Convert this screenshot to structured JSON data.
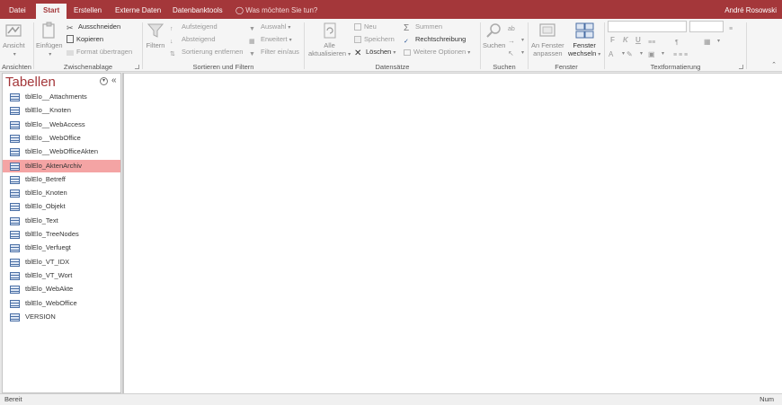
{
  "tabs": [
    {
      "label": "Datei"
    },
    {
      "label": "Start"
    },
    {
      "label": "Erstellen"
    },
    {
      "label": "Externe Daten"
    },
    {
      "label": "Datenbanktools"
    }
  ],
  "tell_me": "Was möchten Sie tun?",
  "user_name": "André Rosowski",
  "ribbon": {
    "ansichten": {
      "ansicht": "Ansicht",
      "label": "Ansichten"
    },
    "zwischenablage": {
      "einfuegen": "Einfügen",
      "ausschneiden": "Ausschneiden",
      "kopieren": "Kopieren",
      "format": "Format übertragen",
      "label": "Zwischenablage"
    },
    "sortieren": {
      "filtern": "Filtern",
      "aufsteigend": "Aufsteigend",
      "absteigend": "Absteigend",
      "sortierung_entfernen": "Sortierung entfernen",
      "auswahl": "Auswahl",
      "erweitert": "Erweitert",
      "filter_ein_aus": "Filter ein/aus",
      "label": "Sortieren und Filtern"
    },
    "datensaetze": {
      "alle": "Alle",
      "aktualisieren": "aktualisieren",
      "neu": "Neu",
      "speichern": "Speichern",
      "loeschen": "Löschen",
      "summen": "Summen",
      "rechtschreibung": "Rechtschreibung",
      "weitere": "Weitere Optionen",
      "label": "Datensätze"
    },
    "suchen": {
      "suchen": "Suchen",
      "label": "Suchen"
    },
    "fenster": {
      "anpassen_1": "An Fenster",
      "anpassen_2": "anpassen",
      "wechseln_1": "Fenster",
      "wechseln_2": "wechseln",
      "label": "Fenster"
    },
    "textformatierung": {
      "fett": "F",
      "kursiv": "K",
      "unterstrichen": "U",
      "label": "Textformatierung"
    }
  },
  "nav": {
    "title": "Tabellen",
    "items": [
      {
        "label": "tblElo__Attachments",
        "selected": false
      },
      {
        "label": "tblElo__Knoten",
        "selected": false
      },
      {
        "label": "tblElo__WebAccess",
        "selected": false
      },
      {
        "label": "tblElo__WebOffice",
        "selected": false
      },
      {
        "label": "tblElo__WebOfficeAkten",
        "selected": false
      },
      {
        "label": "tblElo_AktenArchiv",
        "selected": true
      },
      {
        "label": "tblElo_Betreff",
        "selected": false
      },
      {
        "label": "tblElo_Knoten",
        "selected": false
      },
      {
        "label": "tblElo_Objekt",
        "selected": false
      },
      {
        "label": "tblElo_Text",
        "selected": false
      },
      {
        "label": "tblElo_TreeNodes",
        "selected": false
      },
      {
        "label": "tblElo_Verfuegt",
        "selected": false
      },
      {
        "label": "tblElo_VT_IDX",
        "selected": false
      },
      {
        "label": "tblElo_VT_Wort",
        "selected": false
      },
      {
        "label": "tblElo_WebAkte",
        "selected": false
      },
      {
        "label": "tblElo_WebOffice",
        "selected": false
      },
      {
        "label": "VERSION",
        "selected": false
      }
    ]
  },
  "status": {
    "left": "Bereit",
    "right": "Num"
  },
  "colors": {
    "accent": "#a4373a",
    "selection": "#f4a4a4"
  }
}
